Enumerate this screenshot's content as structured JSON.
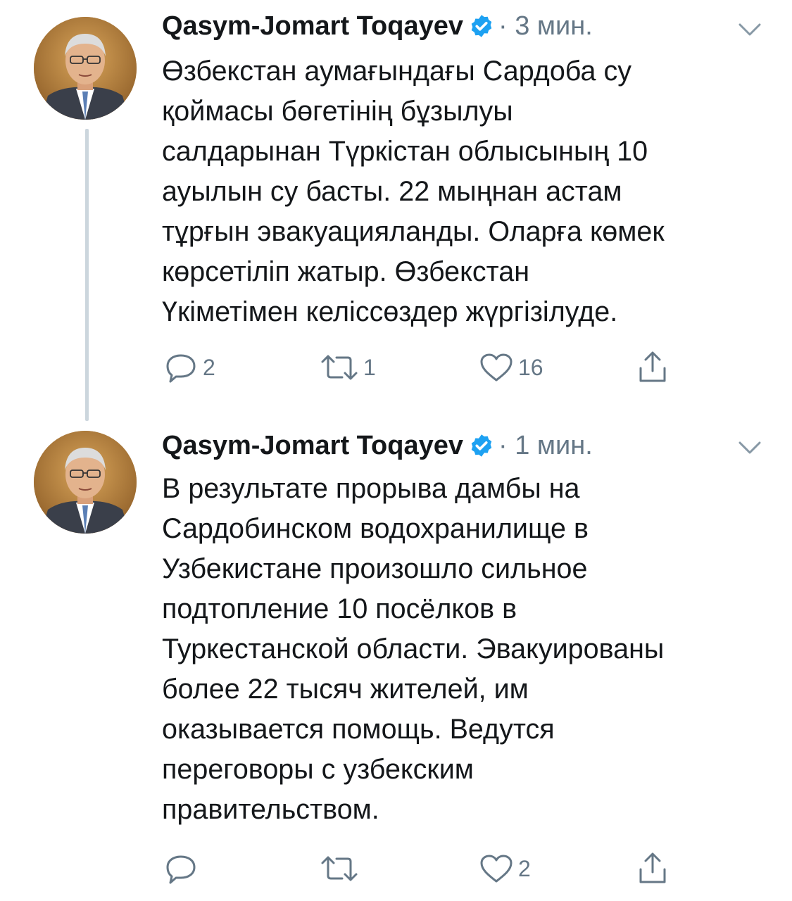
{
  "thread": {
    "tweets": [
      {
        "author_name": "Qasym-Jomart Toqayev",
        "verified": true,
        "time": "· 3 мин.",
        "text": "Өзбекстан аумағындағы Сардоба су\nқоймасы бөгетінің бұзылуы\nсалдарынан Түркістан облысының 10\nауылын су басты. 22 мыңнан астам\nтұрғын эвакуацияланды. Оларға көмек\nкөрсетіліп жатыр. Өзбекстан\nҮкіметімен келіссөздер жүргізілуде.",
        "reply_count": "2",
        "retweet_count": "1",
        "like_count": "16"
      },
      {
        "author_name": "Qasym-Jomart Toqayev",
        "verified": true,
        "time": "· 1 мин.",
        "text": "В результате прорыва дамбы на\nСардобинском водохранилище в\nУзбекистане произошло сильное\nподтопление 10 посёлков в\nТуркестанской области. Эвакуированы\nболее 22 тысяч жителей, им\nоказывается помощь. Ведутся\nпереговоры с узбекским\nправительством.",
        "reply_count": "",
        "retweet_count": "",
        "like_count": "2"
      }
    ]
  },
  "icons": {
    "verified": "verified-badge-icon",
    "caret": "chevron-down-icon",
    "reply": "reply-icon",
    "retweet": "retweet-icon",
    "like": "heart-icon",
    "share": "share-icon"
  },
  "colors": {
    "text": "#14171a",
    "secondary": "#657786",
    "verified_blue": "#1da1f2",
    "thread_line": "#ccd6dd"
  }
}
